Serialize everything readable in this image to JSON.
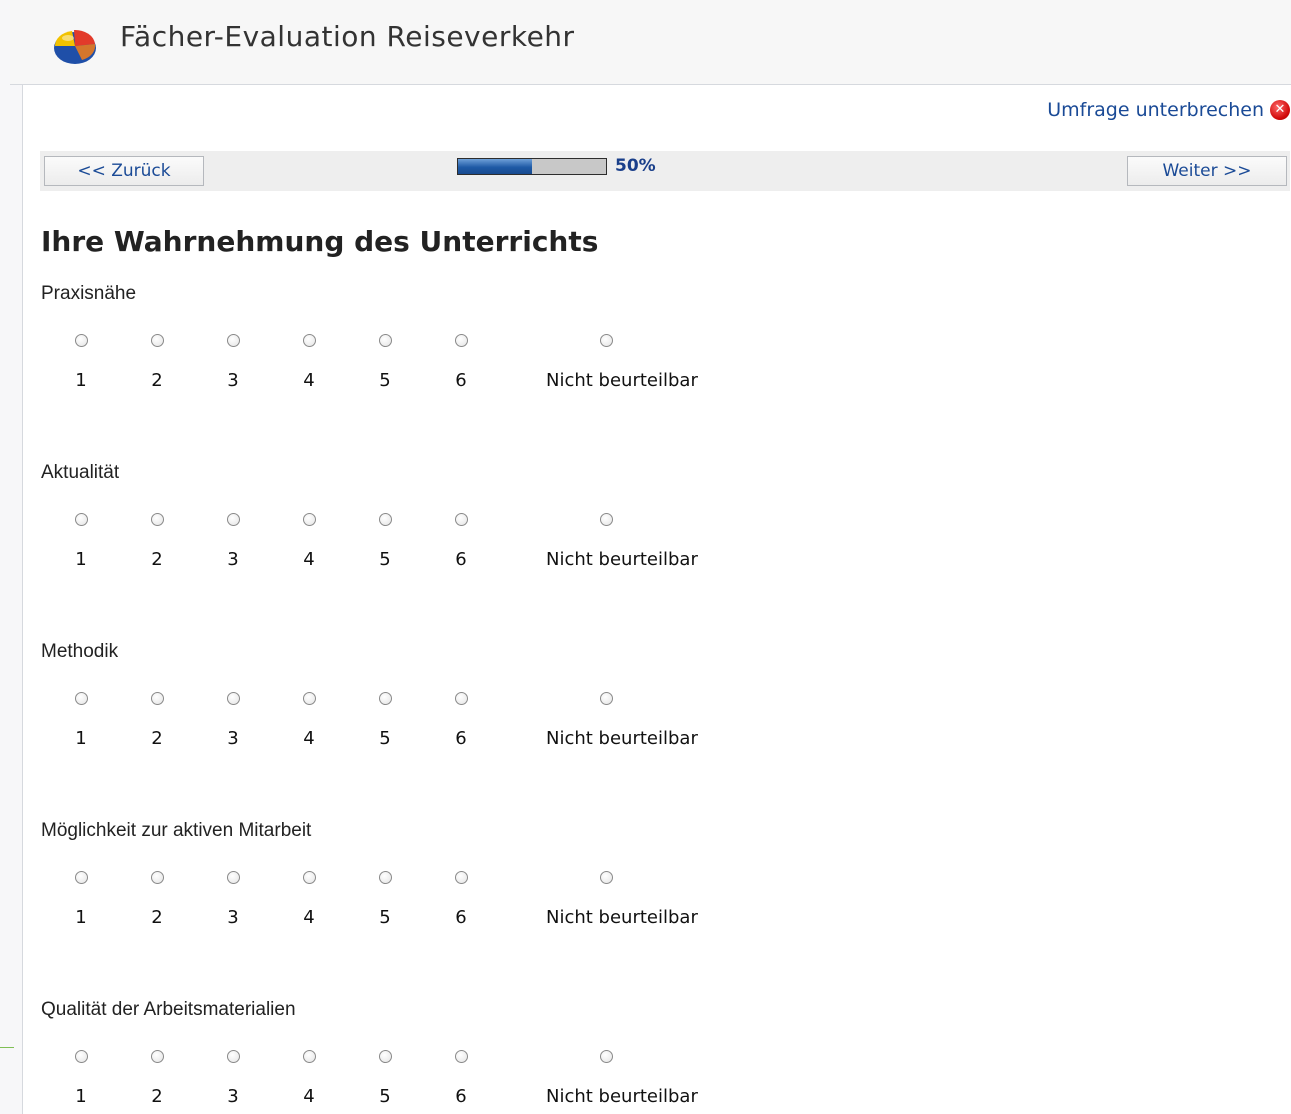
{
  "header": {
    "app_title": "Fächer-Evaluation Reiseverkehr",
    "logo_icon": "pie-chart-logo-icon"
  },
  "toolbar": {
    "interrupt_label": "Umfrage unterbrechen",
    "interrupt_icon": "close-icon",
    "back_label": "<< Zurück",
    "next_label": "Weiter >>",
    "progress_percent": 50,
    "progress_label": "50%"
  },
  "section": {
    "title": "Ihre Wahrnehmung des Unterrichts"
  },
  "options": [
    "1",
    "2",
    "3",
    "4",
    "5",
    "6",
    "Nicht beurteilbar"
  ],
  "questions": [
    {
      "label": "Praxisnähe"
    },
    {
      "label": "Aktualität"
    },
    {
      "label": "Methodik"
    },
    {
      "label": "Möglichkeit zur aktiven Mitarbeit"
    },
    {
      "label": "Qualität der Arbeitsmaterialien"
    }
  ],
  "colors": {
    "link": "#1a4a96",
    "progress_fill": "#1f5aa6",
    "header_bg": "#f7f7f7"
  }
}
